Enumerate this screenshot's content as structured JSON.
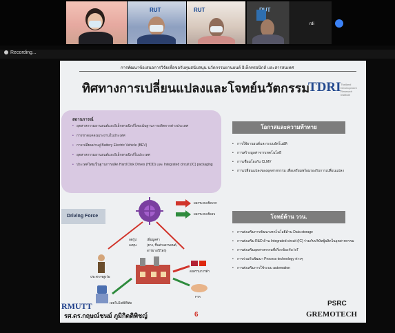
{
  "meeting": {
    "participant_name": "rdi",
    "recording_label": "Recording...",
    "rut_logo_text": "RUT"
  },
  "slide": {
    "header_line": "การพัฒนาข้อเสนอการวิจัยเพื่อขอรับทุนสนับสนุน นวัตกรรมยานยนต์ อิเล็กทรอนิกส์ และสารสนเทศ",
    "title": "ทิศทางการเปลี่ยนแปลงและโจทย์นวัตกรรม",
    "logo": "TDRI",
    "logo_sub": "Thailand Development Research Institute",
    "status_box": {
      "title": "สถานการณ์",
      "items": [
        "อุตสาหกรรมยานยนต์และอิเล็กทรอนิกส์ไทยเน้นฐานการผลิตจากต่างประเทศ",
        "การขาดแคลนแรงงานในประเทศ",
        "การเปลี่ยนผ่านสู่ Battery Electric Vehicle (BEV)",
        "อุตสาหกรรมยานยนต์และอิเล็กทรอนิกส์ในประเทศ",
        "ประเทศไทยเป็นฐานการผลิต Hard Disk Drives (HDD) และ Integrated circuit (IC) packaging"
      ]
    },
    "opportunity_banner": "โอกาสและความท้าทาย",
    "opportunity_items": [
      "การใช้ยานยนต์และระบบอัตโนมัติ",
      "การสร้างมูลค่าจากเทคโนโลยี",
      "การเชื่อมโยงกับ CLMV",
      "การเปลี่ยนแปลงของอุตสาหกรรม เพื่อเตรียมพร้อมรองรับการเปลี่ยนแปลง"
    ],
    "challenge_banner": "โจทย์ด้าน ววน.",
    "challenge_items": [
      "การส่งเสริมการพัฒนาเทคโนโลยีด้าน Data storage",
      "การส่งเสริม R&D ด้าน Integrated circuit (IC) ร่วมกับบริษัทผู้ผลิตในอุตสาหกรรม",
      "การส่งเสริมอุตสาหกรรมที่เกี่ยวข้องกับ IoT",
      "การร่วมกันพัฒนา Process technology ต่างๆ",
      "การส่งเสริมการใช้ระบบ automation"
    ],
    "driving_force": "Driving Force",
    "diagram_labels": {
      "positive": "ผลกระทบเชิงบวก",
      "negative": "ผลกระทบเชิงลบ",
      "center_left": "ลดรูป",
      "center_left2": "ลงทุน",
      "center_mid": "เพิ่มมูลค่า",
      "center_mid2": "(ยาง, ชิ้นส่วนยานยนต์,",
      "center_mid3": "สารยาง/ปิโตร)",
      "aging": "ประชากรสูงวัย",
      "tech": "เทคโนโลยีดิจิทัล",
      "trade": "สงครามการค้า",
      "fta": "FTA"
    },
    "presenter": "รศ.ดร.กฤษณ์ชนม์ ภูมิกิตติพิชญ์",
    "page_number": "6",
    "footer_left_logo": "RMUTT",
    "footer_right_logo1": "PSRC",
    "footer_right_logo2": "GREMOTECH"
  },
  "colors": {
    "status_box": "#d9c9e2",
    "banner": "#7d7d7d",
    "accent_red": "#d1342b",
    "tdri_blue": "#244a8f"
  }
}
